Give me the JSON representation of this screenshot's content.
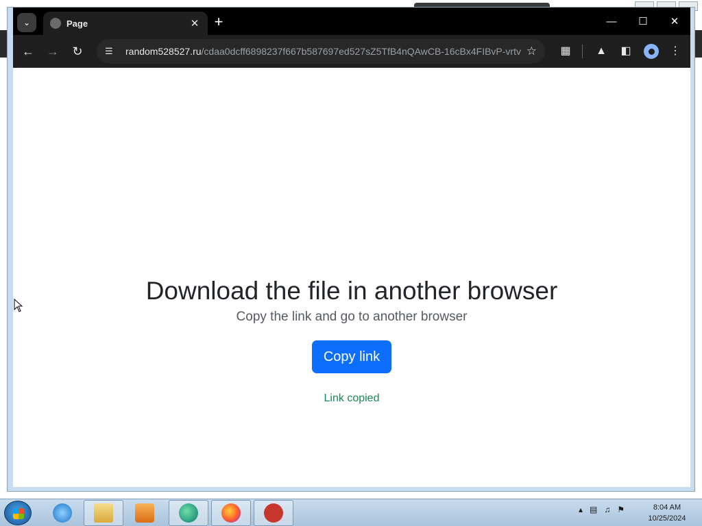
{
  "browser": {
    "tab_title": "Page",
    "url_host": "random528527.ru",
    "url_path": "/cdaa0dcff6898237f667b587697ed527sZ5TfB4nQAwCB-16cBx4FIBvP-vrtv-..."
  },
  "page": {
    "heading": "Download the file in another browser",
    "subheading": "Copy the link and go to another browser",
    "copy_button": "Copy link",
    "status": "Link copied"
  },
  "taskbar": {
    "time": "8:04 AM",
    "date": "10/25/2024"
  },
  "colors": {
    "button": "#0d6efd",
    "status": "#198754",
    "chrome_dark": "#1f1f1f"
  }
}
